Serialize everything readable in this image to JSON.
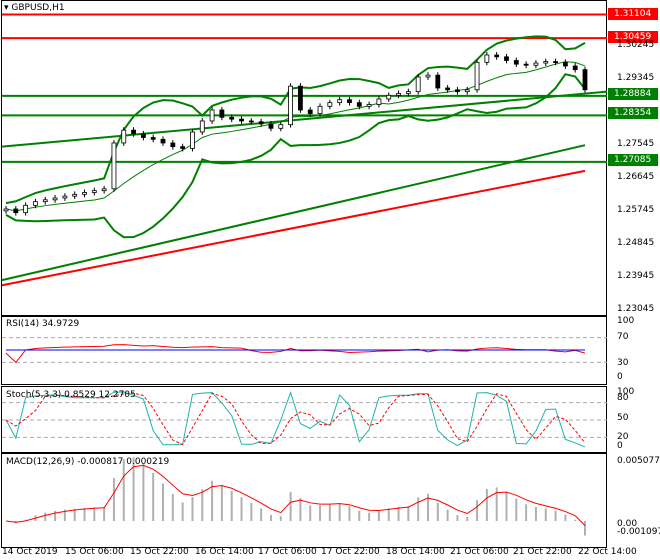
{
  "symbol": "GBPUSD,H1",
  "levels": [
    {
      "value": "1.31104",
      "color": "#ff0000"
    },
    {
      "value": "1.30459",
      "color": "#ff0000"
    },
    {
      "value": "1.28884",
      "color": "#008000"
    },
    {
      "value": "1.28354",
      "color": "#008000"
    },
    {
      "value": "1.27085",
      "color": "#008000"
    }
  ],
  "price_axis": [
    "1.30245",
    "1.29345",
    "1.27545",
    "1.26645",
    "1.25745",
    "1.24845",
    "1.23945",
    "1.23045"
  ],
  "rsi": {
    "label": "RSI(14) 34.9729",
    "axis": [
      "100",
      "70",
      "30",
      "0"
    ]
  },
  "stoch": {
    "label": "Stoch(5,3,3) 0.8529 12.2705",
    "axis": [
      "100",
      "80",
      "50",
      "20",
      "0"
    ]
  },
  "macd": {
    "label": "MACD(12,26,9) -0.000817 0.000219",
    "axis": [
      "0.005077",
      "0.00",
      "-0.001097"
    ]
  },
  "time_axis": [
    "14 Oct 2019",
    "15 Oct 06:00",
    "15 Oct 22:00",
    "16 Oct 14:00",
    "17 Oct 06:00",
    "17 Oct 22:00",
    "18 Oct 14:00",
    "21 Oct 06:00",
    "21 Oct 22:00",
    "22 Oct 14:00"
  ],
  "chart_data": {
    "type": "candlestick",
    "closes": [
      1.258,
      1.257,
      1.259,
      1.26,
      1.2605,
      1.261,
      1.2615,
      1.262,
      1.2625,
      1.263,
      1.2635,
      1.276,
      1.2795,
      1.2785,
      1.2775,
      1.277,
      1.276,
      1.275,
      1.2745,
      1.279,
      1.282,
      1.285,
      1.283,
      1.2825,
      1.282,
      1.2818,
      1.2812,
      1.28,
      1.281,
      1.2915,
      1.285,
      1.284,
      1.286,
      1.287,
      1.2878,
      1.287,
      1.286,
      1.2865,
      1.288,
      1.289,
      1.2895,
      1.29,
      1.294,
      1.2945,
      1.291,
      1.2905,
      1.29,
      1.2905,
      1.298,
      1.3,
      1.2995,
      1.2985,
      1.2975,
      1.2972,
      1.2978,
      1.2982,
      1.298,
      1.297,
      1.296,
      1.2905
    ],
    "ma_green": [
      1.2386,
      1.2754
    ],
    "ma_red": [
      1.2372,
      1.2684
    ],
    "trend_green": [
      1.275,
      1.29
    ],
    "ylim": [
      1.228,
      1.315
    ]
  }
}
